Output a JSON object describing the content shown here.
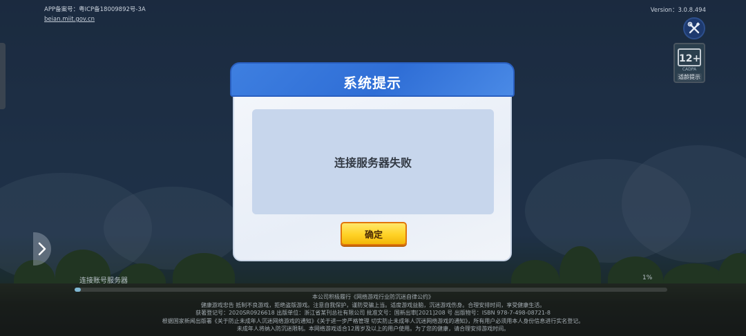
{
  "top_left": {
    "icp_text": "APP备案号：粤ICP备18009892号-3A",
    "icp_link": "beian.miit.gov.cn"
  },
  "version": "Version：3.0.8.494",
  "age_rating": {
    "number": "12+",
    "code": "CADPA",
    "tip": "适龄提示"
  },
  "dialog": {
    "title": "系统提示",
    "message": "连接服务器失败",
    "ok_label": "确定"
  },
  "loading": {
    "label": "连接账号服务器",
    "percent_text": "1%",
    "progress": 0.01
  },
  "footer": {
    "lines": [
      "本公司积极履行《网络游戏行业防沉迷自律公约》",
      "健康游戏忠告 抵制不良游戏，拒绝盗版游戏。注意自我保护，谨防受骗上当。适度游戏益脑，沉迷游戏伤身。合理安排时间，享受健康生活。",
      "获著登记号：2020SR0926618 出版单位：浙江省某刊总社有限公司 批准文号：国新出审[2021]208 号 出版物号：ISBN 978-7-498-08721-8",
      "根据国家新闻出版署《关于防止未成年人沉迷网络游戏的通知》《关于进一步严格管理 切实防止未成年人沉迷网络游戏的通知》，所有用户必须用本人身份信息进行实名登记。",
      "未成年人将纳入防沉迷限制。本网络游戏适合12周岁及以上的用户使用。为了您的健康，请合理安排游戏时间。"
    ]
  }
}
